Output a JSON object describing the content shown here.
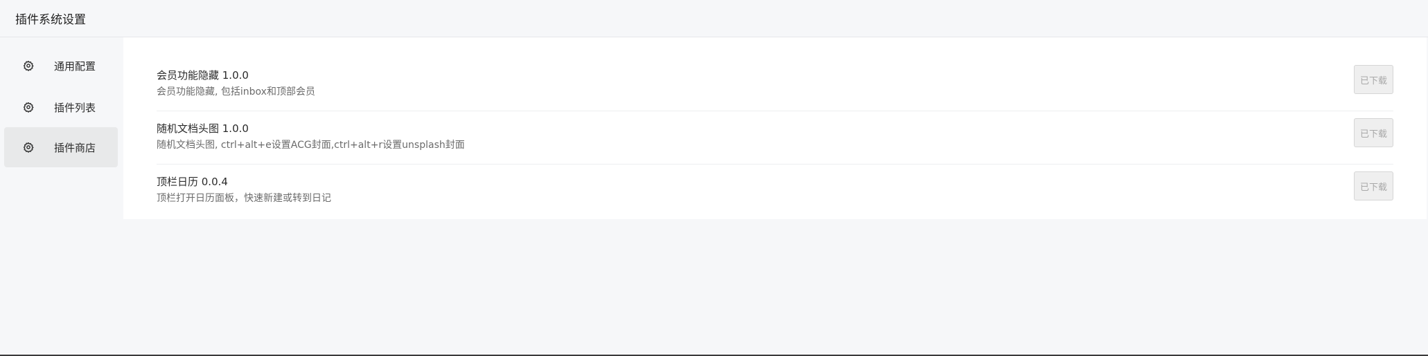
{
  "header": {
    "title": "插件系统设置"
  },
  "sidebar": {
    "items": [
      {
        "label": "通用配置",
        "icon": "gear-icon",
        "active": false
      },
      {
        "label": "插件列表",
        "icon": "gear-icon",
        "active": false
      },
      {
        "label": "插件商店",
        "icon": "gear-icon",
        "active": true
      }
    ]
  },
  "plugins": [
    {
      "name": "会员功能隐藏 1.0.0",
      "desc": "会员功能隐藏, 包括inbox和顶部会员",
      "button": "已下载"
    },
    {
      "name": "随机文档头图 1.0.0",
      "desc": "随机文档头图, ctrl+alt+e设置ACG封面,ctrl+alt+r设置unsplash封面",
      "button": "已下载"
    },
    {
      "name": "顶栏日历 0.0.4",
      "desc": "顶栏打开日历面板，快速新建或转到日记",
      "button": "已下载"
    }
  ]
}
